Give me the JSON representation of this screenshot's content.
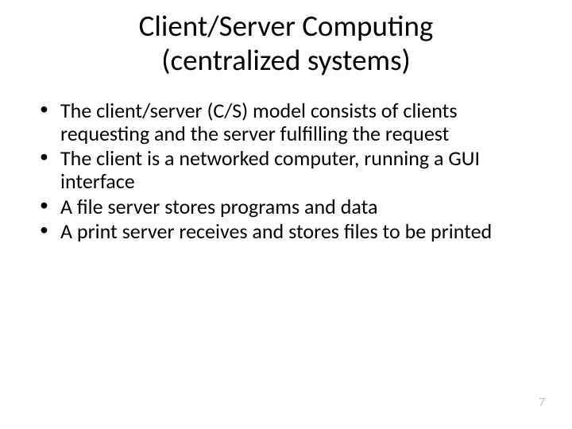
{
  "title_line1": "Client/Server Computing",
  "title_line2": "(centralized systems)",
  "bullets": [
    "The client/server (C/S) model consists of clients requesting and the server fulfilling the request",
    "The client is a networked computer, running a GUI interface",
    "A file server stores programs and data",
    "A print server receives and stores files to be printed"
  ],
  "page_number": "7"
}
